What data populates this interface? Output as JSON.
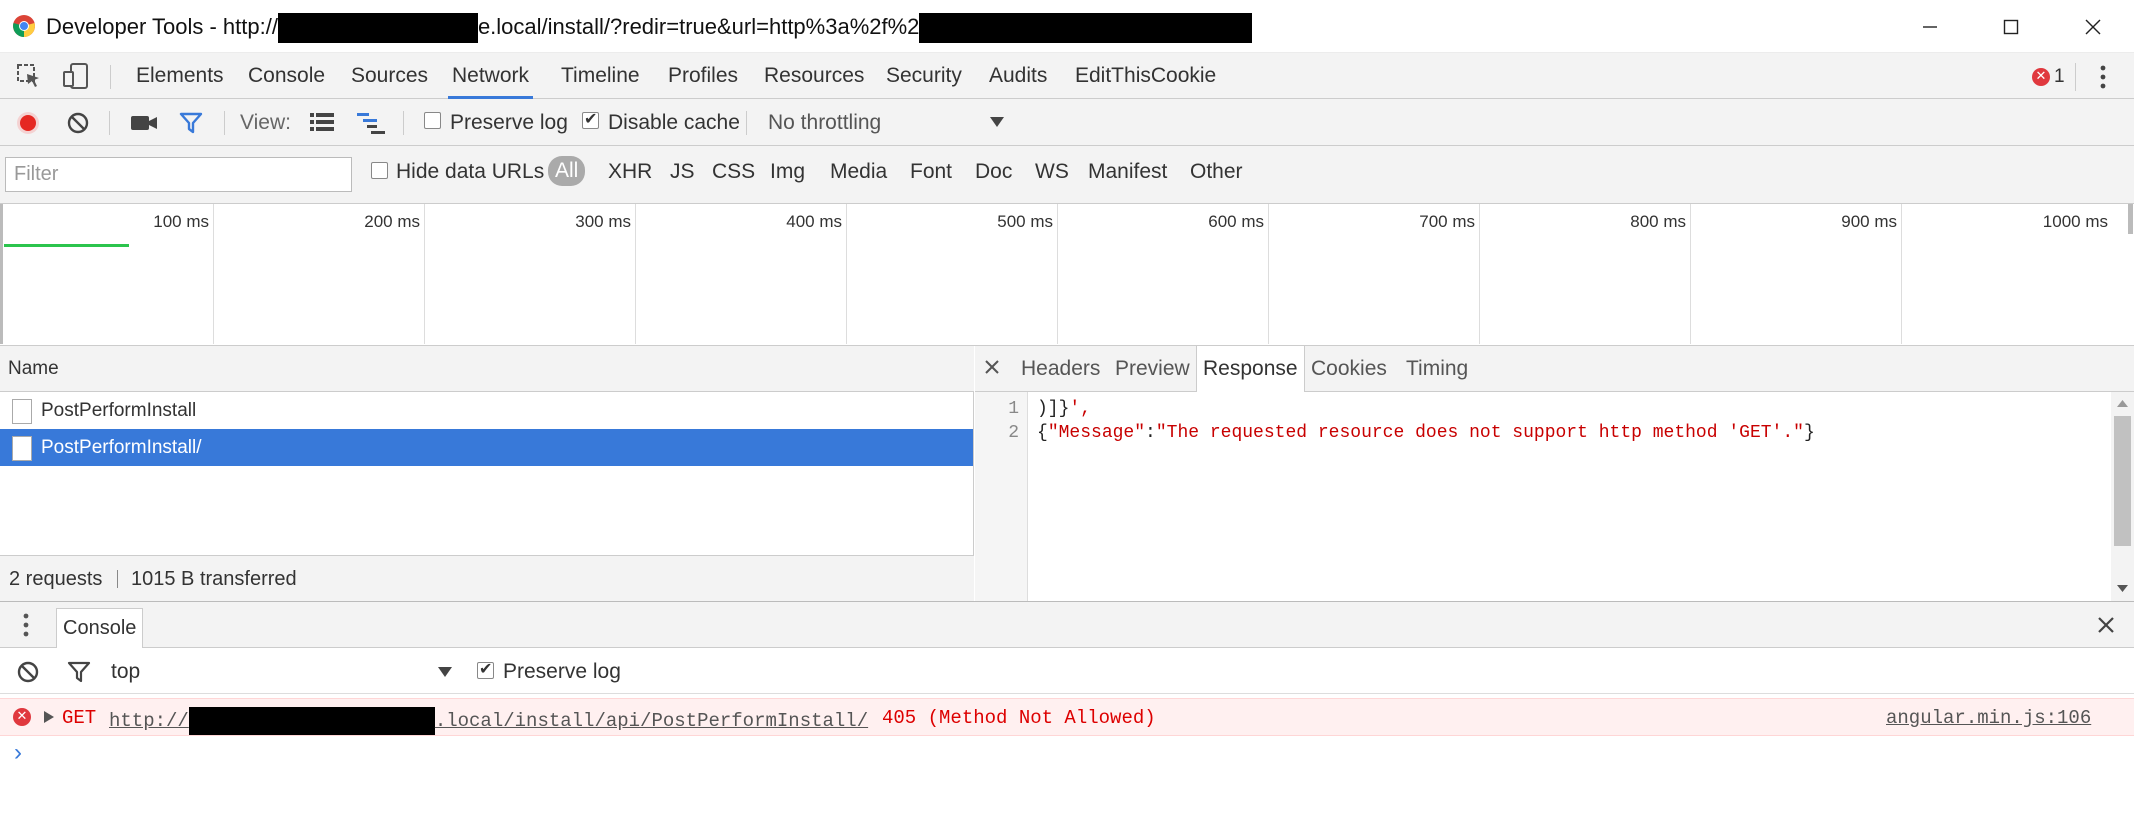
{
  "window": {
    "title_prefix": "Developer Tools - http://",
    "title_middle": "e.local/install/?redir=true&url=http%3a%2f%2",
    "controls": {
      "minimize": "—",
      "maximize": "☐",
      "close": "✕"
    }
  },
  "main_tabs": [
    "Elements",
    "Console",
    "Sources",
    "Network",
    "Timeline",
    "Profiles",
    "Resources",
    "Security",
    "Audits",
    "EditThisCookie"
  ],
  "active_main_tab": "Network",
  "error_count": "1",
  "toolbar": {
    "view_label": "View:",
    "preserve_log": "Preserve log",
    "preserve_log_checked": false,
    "disable_cache": "Disable cache",
    "disable_cache_checked": true,
    "throttling": "No throttling"
  },
  "filterbar": {
    "placeholder": "Filter",
    "hide_data_urls": "Hide data URLs",
    "types": [
      "All",
      "XHR",
      "JS",
      "CSS",
      "Img",
      "Media",
      "Font",
      "Doc",
      "WS",
      "Manifest",
      "Other"
    ],
    "active_type": "All"
  },
  "overview": {
    "ticks": [
      "100 ms",
      "200 ms",
      "300 ms",
      "400 ms",
      "500 ms",
      "600 ms",
      "700 ms",
      "800 ms",
      "900 ms",
      "1000 ms"
    ]
  },
  "requests": {
    "column_name": "Name",
    "rows": [
      {
        "name": "PostPerformInstall",
        "selected": false
      },
      {
        "name": "PostPerformInstall/",
        "selected": true
      }
    ],
    "summary_count": "2 requests",
    "summary_transferred": "1015 B transferred"
  },
  "detail": {
    "tabs": [
      "Headers",
      "Preview",
      "Response",
      "Cookies",
      "Timing"
    ],
    "active_tab": "Response",
    "lines": [
      {
        "no": "1",
        "text": ")]}',",
        "plain": ")]}",
        "str": "',"
      },
      {
        "no": "2",
        "open": "{",
        "key": "\"Message\"",
        "colon": ":",
        "value": "\"The requested resource does not support http method 'GET'.\"",
        "close": "}"
      }
    ]
  },
  "console": {
    "tab_label": "Console",
    "context": "top",
    "preserve_log": "Preserve log",
    "preserve_log_checked": true,
    "error": {
      "method": "GET",
      "url_prefix": "http://",
      "url_suffix": ".local/install/api/PostPerformInstall/",
      "status": "405 (Method Not Allowed)",
      "source": "angular.min.js:106"
    },
    "prompt": "›"
  },
  "colors": {
    "accent": "#3879d9",
    "error_red": "#e0383e",
    "string_red": "#c80000",
    "record_red": "#e52822",
    "timeline_green": "#2bc44d"
  }
}
